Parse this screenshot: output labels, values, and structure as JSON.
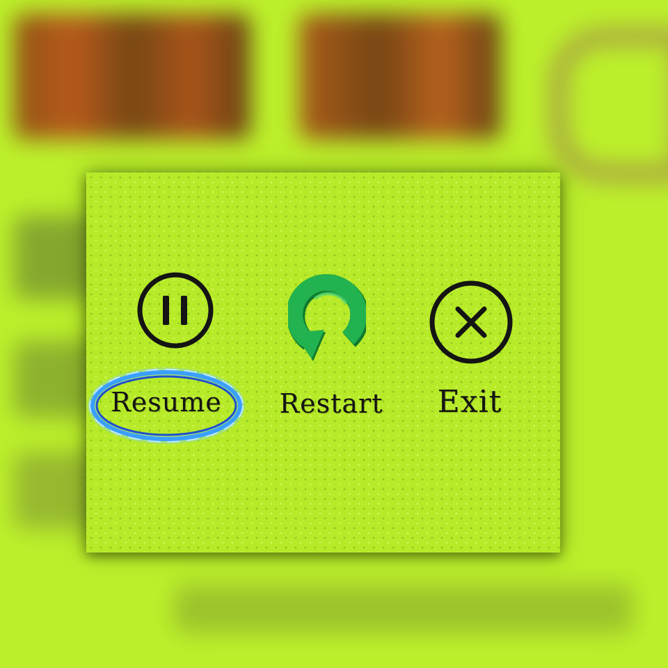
{
  "menu": {
    "resume": {
      "label": "Resume",
      "icon": "pause-icon",
      "selected": true
    },
    "restart": {
      "label": "Restart",
      "icon": "restart-arrow-icon"
    },
    "exit": {
      "label": "Exit",
      "icon": "close-circle-icon"
    }
  },
  "colors": {
    "panel": "#b7ea28",
    "icon_stroke": "#141414",
    "restart_icon": "#1faa4a",
    "selection_glow": "#3aa0ff"
  }
}
